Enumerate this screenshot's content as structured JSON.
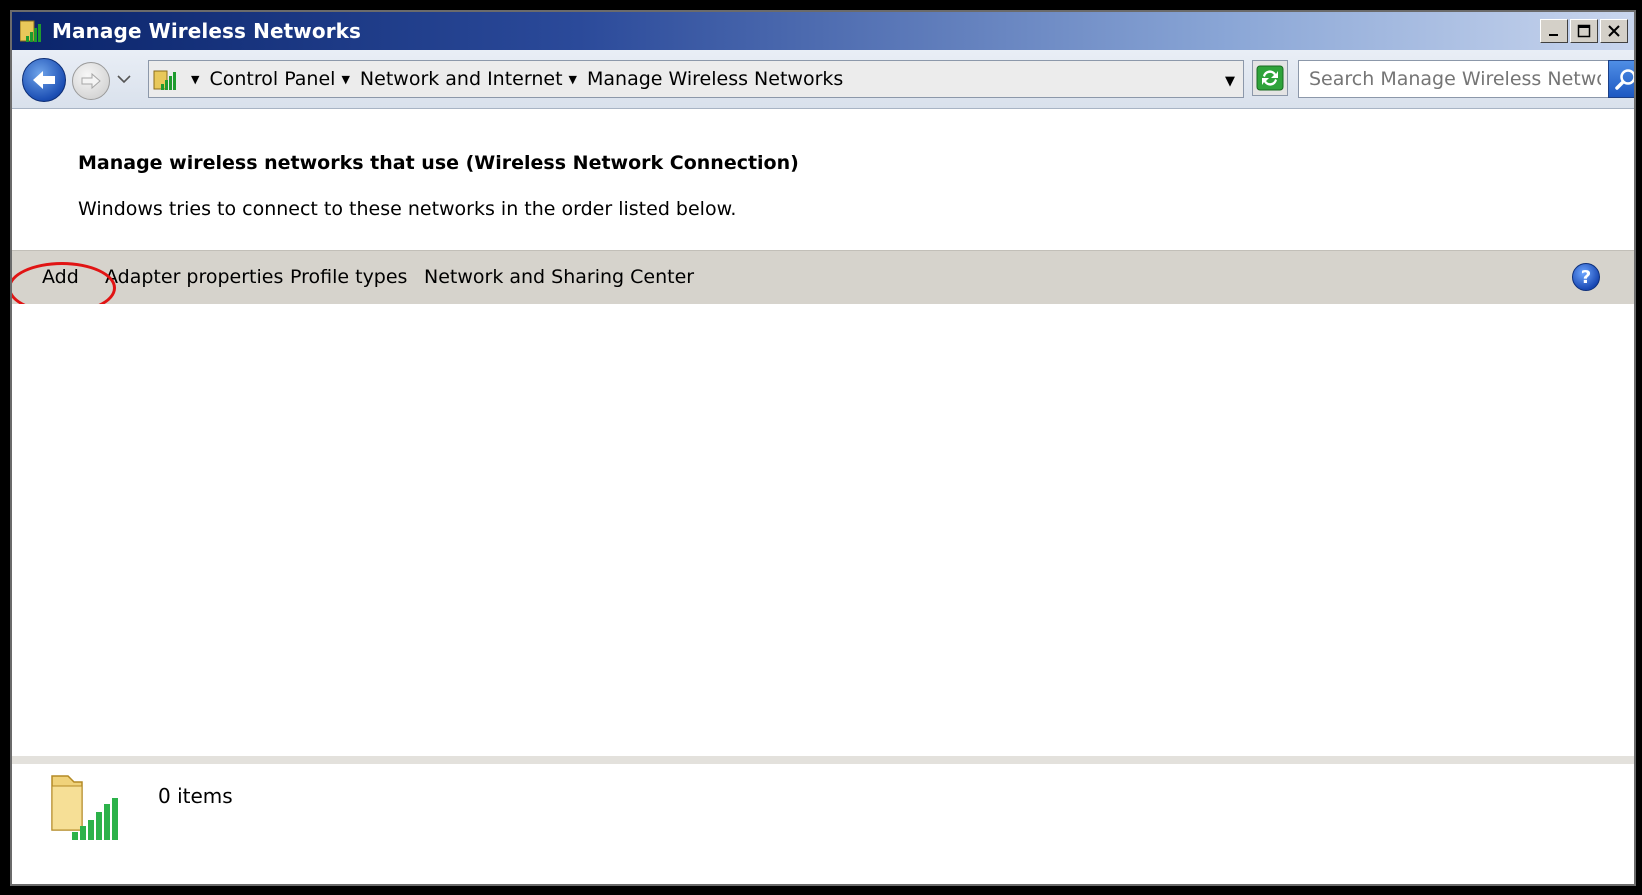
{
  "window": {
    "title": "Manage Wireless Networks"
  },
  "address_bar": {
    "breadcrumbs": [
      "Control Panel",
      "Network and Internet",
      "Manage Wireless Networks"
    ],
    "search_placeholder": "Search Manage Wireless Networks"
  },
  "content": {
    "heading": "Manage wireless networks that use (Wireless Network Connection)",
    "description": "Windows tries to connect to these networks in the order listed below."
  },
  "command_bar": {
    "add": "Add",
    "adapter_properties": "Adapter properties",
    "profile_types": "Profile types",
    "network_sharing_center": "Network and Sharing Center",
    "help": "?"
  },
  "details": {
    "items_count": "0 items"
  },
  "colors": {
    "title_bar_start": "#0a246a",
    "command_bar": "#d6d3cc",
    "annotation": "#e11414"
  },
  "icons": {
    "app": "wireless-signal-icon",
    "back": "back-arrow-icon",
    "forward": "forward-arrow-icon",
    "refresh": "refresh-icon",
    "search": "search-icon",
    "help": "help-icon",
    "details": "wireless-folder-icon"
  }
}
